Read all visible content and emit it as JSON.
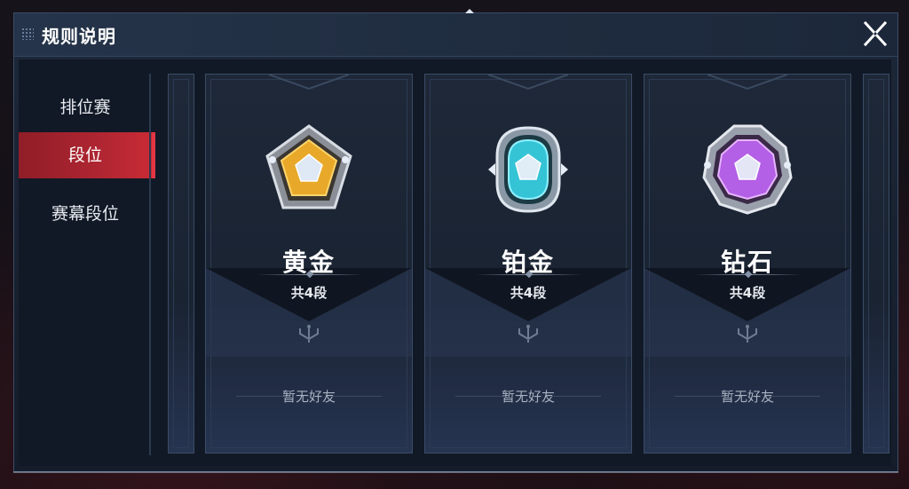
{
  "dialog": {
    "title": "规则说明",
    "close_icon": "close-x-icon"
  },
  "sidebar": {
    "items": [
      {
        "label": "排位赛",
        "active": false
      },
      {
        "label": "段位",
        "active": true
      },
      {
        "label": "赛幕段位",
        "active": false
      }
    ]
  },
  "ranks": [
    {
      "name": "黄金",
      "tiers": "共4段",
      "friends": "暂无好友",
      "badge_icon": "gold-badge-icon",
      "color": "#e8a92a"
    },
    {
      "name": "铂金",
      "tiers": "共4段",
      "friends": "暂无好友",
      "badge_icon": "platinum-badge-icon",
      "color": "#35c4d6"
    },
    {
      "name": "钻石",
      "tiers": "共4段",
      "friends": "暂无好友",
      "badge_icon": "diamond-badge-icon",
      "color": "#b35fe6"
    }
  ],
  "colors": {
    "active_tab": "#b42733",
    "accent_red": "#e23644",
    "panel_bg": "#1c2738"
  }
}
